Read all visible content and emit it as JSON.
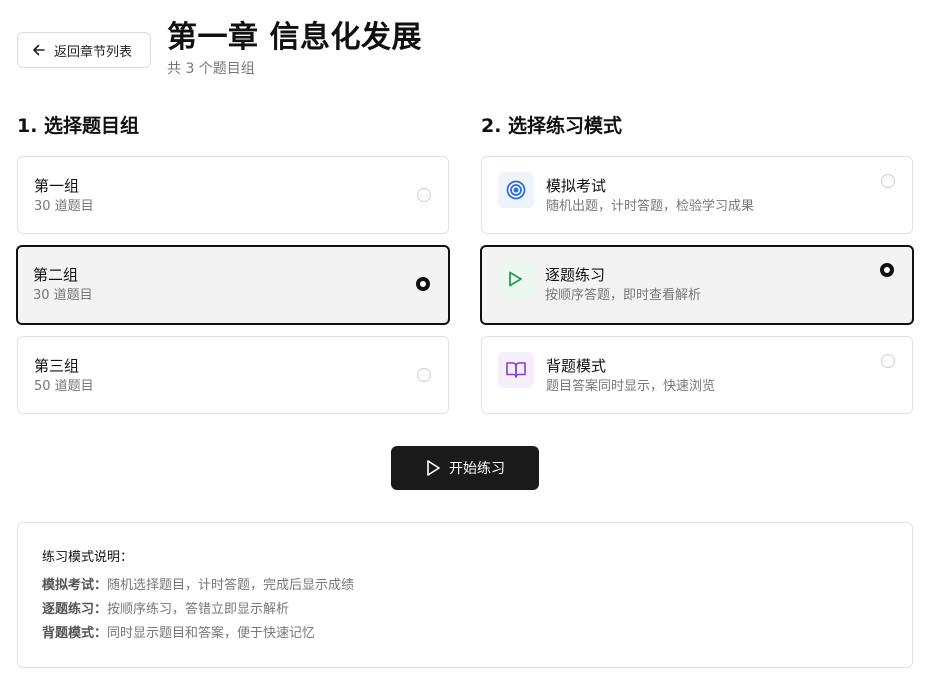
{
  "header": {
    "back_label": "返回章节列表",
    "title": "第一章 信息化发展",
    "subtitle": "共 3 个题目组"
  },
  "groups_section": {
    "title": "1. 选择题目组",
    "items": [
      {
        "name": "第一组",
        "count": "30 道题目",
        "selected": false
      },
      {
        "name": "第二组",
        "count": "30 道题目",
        "selected": true
      },
      {
        "name": "第三组",
        "count": "50 道题目",
        "selected": false
      }
    ]
  },
  "modes_section": {
    "title": "2. 选择练习模式",
    "items": [
      {
        "name": "模拟考试",
        "desc": "随机出题，计时答题，检验学习成果",
        "icon": "target-icon",
        "icon_color": "#2d6cd8",
        "icon_bg": "#eef3fc",
        "selected": false
      },
      {
        "name": "逐题练习",
        "desc": "按顺序答题，即时查看解析",
        "icon": "play-icon",
        "icon_color": "#1f9d4c",
        "icon_bg": "#ecf7ef",
        "selected": true
      },
      {
        "name": "背题模式",
        "desc": "题目答案同时显示，快速浏览",
        "icon": "book-icon",
        "icon_color": "#8a3fd1",
        "icon_bg": "#f5eefb",
        "selected": false
      }
    ]
  },
  "start_button": {
    "label": "开始练习"
  },
  "info": {
    "title": "练习模式说明：",
    "lines": [
      {
        "term": "模拟考试：",
        "text": "随机选择题目，计时答题，完成后显示成绩"
      },
      {
        "term": "逐题练习：",
        "text": "按顺序练习，答错立即显示解析"
      },
      {
        "term": "背题模式：",
        "text": "同时显示题目和答案，便于快速记忆"
      }
    ]
  },
  "colors": {
    "accent": "#111111",
    "selected_bg": "#f3f3f3",
    "button_bg": "#1a1a1a"
  }
}
